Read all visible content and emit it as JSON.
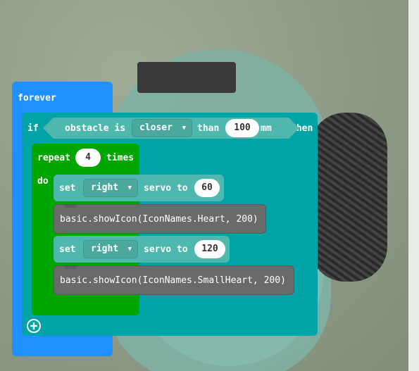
{
  "forever": {
    "label": "forever"
  },
  "if_block": {
    "if_label": "if",
    "then_label": "then",
    "condition": {
      "prefix": "obstacle is",
      "comparator": "closer",
      "than_label": "than",
      "distance": "100",
      "unit": "mm"
    }
  },
  "repeat_block": {
    "repeat_label": "repeat",
    "count": "4",
    "times_label": "times",
    "do_label": "do"
  },
  "statements": [
    {
      "set_label": "set",
      "servo_choice": "right",
      "servo_label": "servo to",
      "angle": "60"
    },
    {
      "code": "basic.showIcon(IconNames.Heart, 200)"
    },
    {
      "set_label": "set",
      "servo_choice": "right",
      "servo_label": "servo to",
      "angle": "120"
    },
    {
      "code": "basic.showIcon(IconNames.SmallHeart, 200)"
    }
  ],
  "colors": {
    "events": "#1e90ff",
    "logic": "#00a4a6",
    "loops": "#00a600",
    "robot": "#4eb7ae",
    "javascript": "#6a6a6a"
  },
  "icons": {
    "dropdown": "chevron-down-icon",
    "add": "plus-circle-icon"
  }
}
